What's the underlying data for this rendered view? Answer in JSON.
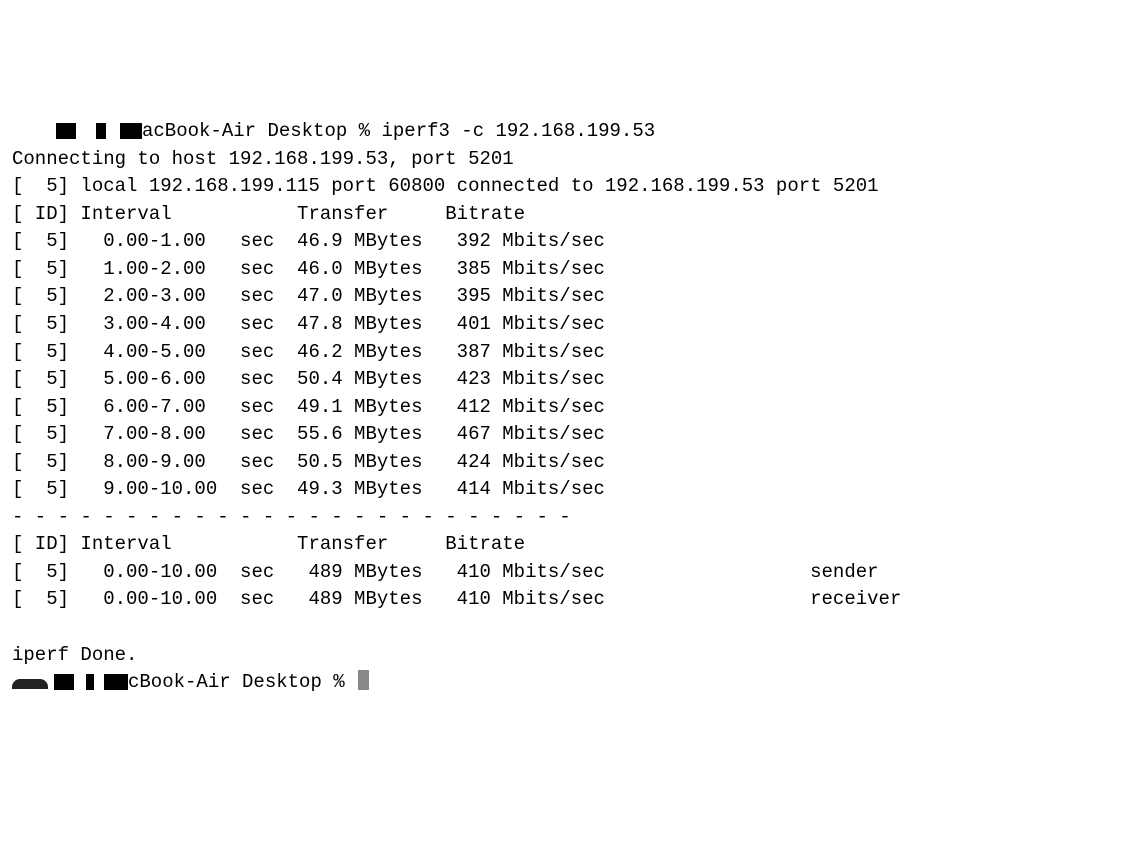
{
  "prompt1": {
    "host_partial": "acBook-Air",
    "cwd": "Desktop",
    "percent": "%",
    "command": "iperf3 -c 192.168.199.53"
  },
  "connecting": "Connecting to host 192.168.199.53, port 5201",
  "local_line": "[  5] local 192.168.199.115 port 60800 connected to 192.168.199.53 port 5201",
  "header1": "[ ID] Interval           Transfer     Bitrate",
  "rows": [
    "[  5]   0.00-1.00   sec  46.9 MBytes   392 Mbits/sec                  ",
    "[  5]   1.00-2.00   sec  46.0 MBytes   385 Mbits/sec                  ",
    "[  5]   2.00-3.00   sec  47.0 MBytes   395 Mbits/sec                  ",
    "[  5]   3.00-4.00   sec  47.8 MBytes   401 Mbits/sec                  ",
    "[  5]   4.00-5.00   sec  46.2 MBytes   387 Mbits/sec                  ",
    "[  5]   5.00-6.00   sec  50.4 MBytes   423 Mbits/sec                  ",
    "[  5]   6.00-7.00   sec  49.1 MBytes   412 Mbits/sec                  ",
    "[  5]   7.00-8.00   sec  55.6 MBytes   467 Mbits/sec                  ",
    "[  5]   8.00-9.00   sec  50.5 MBytes   424 Mbits/sec                  ",
    "[  5]   9.00-10.00  sec  49.3 MBytes   414 Mbits/sec                  "
  ],
  "divider": "- - - - - - - - - - - - - - - - - - - - - - - - -",
  "header2": "[ ID] Interval           Transfer     Bitrate",
  "summary": [
    "[  5]   0.00-10.00  sec   489 MBytes   410 Mbits/sec                  sender",
    "[  5]   0.00-10.00  sec   489 MBytes   410 Mbits/sec                  receiver"
  ],
  "done": "iperf Done.",
  "prompt2": {
    "host_partial": "cBook-Air",
    "cwd": "Desktop",
    "percent": "%"
  }
}
